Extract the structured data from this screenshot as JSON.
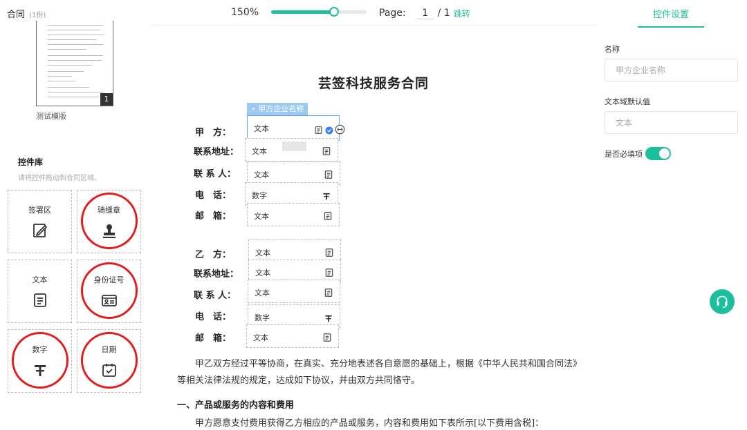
{
  "header": {
    "doc_name": "合同",
    "doc_count": "(1份)",
    "zoom": "150%",
    "zoom_fraction": 0.66,
    "page_label": "Page:",
    "page_current": "1",
    "page_total": "/ 1",
    "jump_label": "跳转",
    "settings_tab": "控件设置"
  },
  "sidebar": {
    "thumbnail_page": "1",
    "thumbnail_label": "测试模版",
    "library_title": "控件库",
    "library_hint": "请将控件拖动到合同区域。",
    "widgets": [
      {
        "label": "签署区",
        "icon": "signature-icon",
        "highlighted": false
      },
      {
        "label": "骑缝章",
        "icon": "stamp-icon",
        "highlighted": true
      },
      {
        "label": "文本",
        "icon": "text-doc-icon",
        "highlighted": false
      },
      {
        "label": "身份证号",
        "icon": "id-card-icon",
        "highlighted": true
      },
      {
        "label": "数字",
        "icon": "number-icon",
        "highlighted": true
      },
      {
        "label": "日期",
        "icon": "calendar-icon",
        "highlighted": true
      }
    ]
  },
  "document": {
    "title": "芸签科技服务合同",
    "selected_tag": "甲方企业名称",
    "party_a": {
      "labels": [
        "甲　方：",
        "联系地址：",
        "联 系 人：",
        "电　话：",
        "邮　箱："
      ],
      "fields": [
        "文本",
        "文本",
        "文本",
        "数字",
        "文本"
      ]
    },
    "party_b": {
      "labels": [
        "乙　方：",
        "联系地址：",
        "联 系 人：",
        "电　话：",
        "邮　箱："
      ],
      "fields": [
        "文本",
        "文本",
        "文本",
        "数字",
        "文本"
      ]
    },
    "intro": "　　甲乙双方经过平等协商，在真实、充分地表述各自意愿的基础上，根据《中华人民共和国合同法》等相关法律法规的规定，达成如下协议，并由双方共同恪守。",
    "section1_title": "一、产品或服务的内容和费用",
    "section1_text": "　　甲方愿意支付费用获得乙方相应的产品或服务，内容和费用如下表所示[以下费用含税]："
  },
  "settings": {
    "name_label": "名称",
    "name_placeholder": "甲方企业名称",
    "default_label": "文本域默认值",
    "default_placeholder": "文本",
    "required_label": "是否必填项",
    "required_on": true
  },
  "colors": {
    "accent": "#1cbf9c",
    "highlight_ring": "#e41c1c",
    "selected_field": "#55a7ee"
  }
}
